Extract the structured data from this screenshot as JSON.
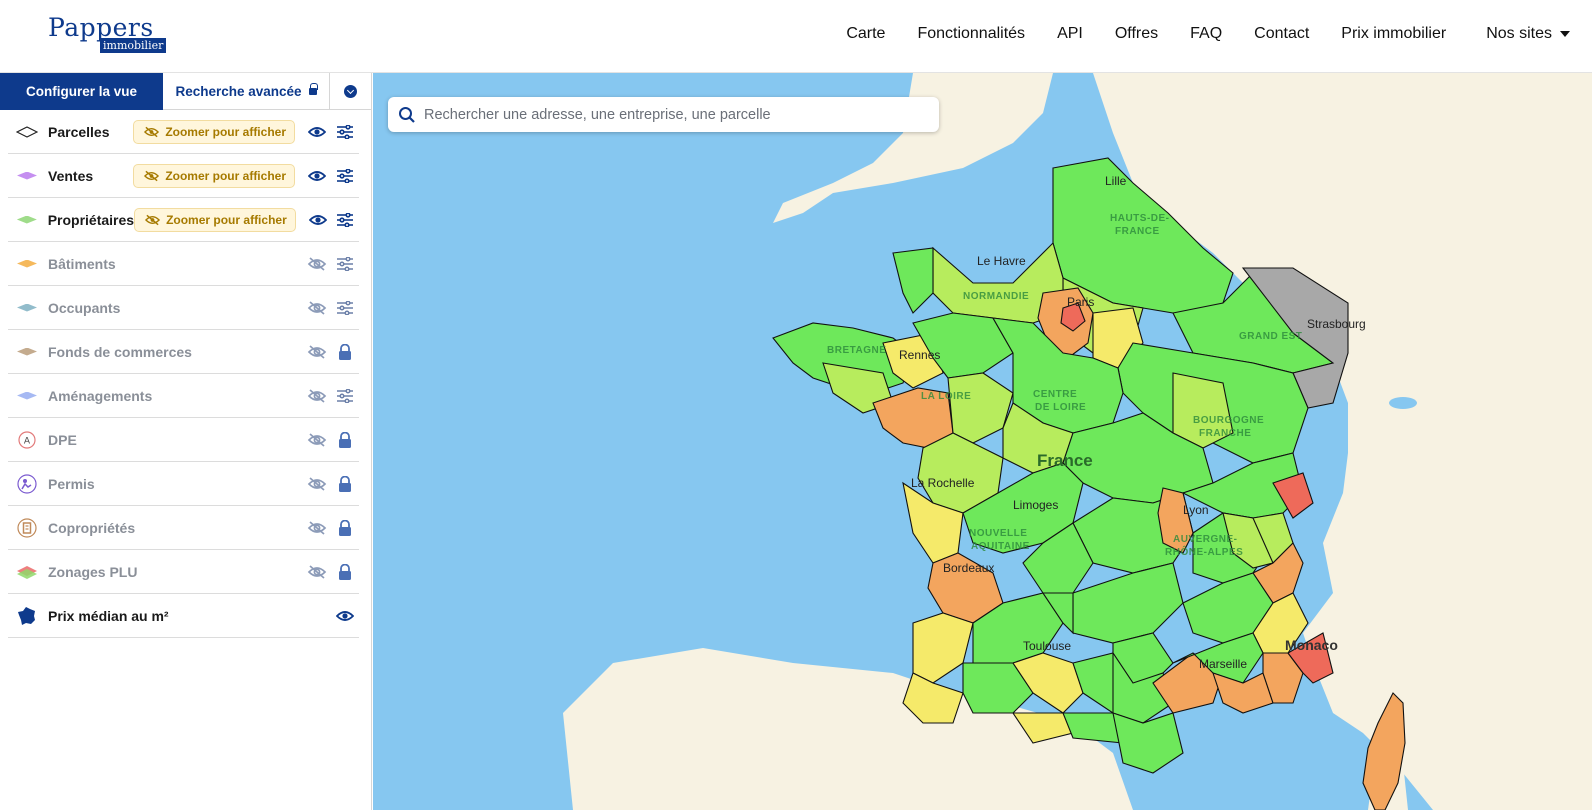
{
  "header": {
    "logo_main": "Pappers",
    "logo_sub": "immobilier",
    "nav": [
      "Carte",
      "Fonctionnalités",
      "API",
      "Offres",
      "FAQ",
      "Contact",
      "Prix immobilier"
    ],
    "sites_label": "Nos sites"
  },
  "sidebar": {
    "tabs": {
      "configure": "Configurer la vue",
      "advanced": "Recherche avancée"
    },
    "zoom_badge": "Zoomer pour afficher",
    "layers": [
      {
        "label": "Parcelles",
        "state": "zoom",
        "action": "settings"
      },
      {
        "label": "Ventes",
        "state": "zoom",
        "action": "settings"
      },
      {
        "label": "Propriétaires",
        "state": "zoom",
        "action": "settings"
      },
      {
        "label": "Bâtiments",
        "state": "hidden",
        "action": "settings"
      },
      {
        "label": "Occupants",
        "state": "hidden",
        "action": "settings"
      },
      {
        "label": "Fonds de commerces",
        "state": "hidden",
        "action": "lock"
      },
      {
        "label": "Aménagements",
        "state": "hidden",
        "action": "settings"
      },
      {
        "label": "DPE",
        "state": "hidden",
        "action": "lock"
      },
      {
        "label": "Permis",
        "state": "hidden",
        "action": "lock"
      },
      {
        "label": "Copropriétés",
        "state": "hidden",
        "action": "lock"
      },
      {
        "label": "Zonages PLU",
        "state": "hidden",
        "action": "lock"
      },
      {
        "label": "Prix médian au m²",
        "state": "visible",
        "action": "none"
      }
    ]
  },
  "map": {
    "search_placeholder": "Rechercher une adresse, une entreprise, une parcelle",
    "labels": {
      "lille": "Lille",
      "le_havre": "Le Havre",
      "paris": "Paris",
      "strasbourg": "Strasbourg",
      "rennes": "Rennes",
      "france": "France",
      "la_rochelle": "La Rochelle",
      "limoges": "Limoges",
      "lyon": "Lyon",
      "bordeaux": "Bordeaux",
      "toulouse": "Toulouse",
      "marseille": "Marseille",
      "monaco": "Monaco"
    },
    "regions": {
      "normandie": "NORMANDIE",
      "bretagne": "BRETAGNE",
      "loire": "LA LOIRE",
      "centre": "CENTRE",
      "centre2": "DE LOIRE",
      "grand_est": "GRAND EST",
      "bourgogne": "BOURGOGNE",
      "bourgogne2": "FRANCHE",
      "nouvelle": "NOUVELLE",
      "nouvelle2": "AQUITAINE",
      "auvergne": "AUVERGNE-",
      "auvergne2": "RHÔNE-ALPES",
      "hauts": "HAUTS-DE-",
      "hauts2": "FRANCE"
    },
    "colors": {
      "green": "#6ee85b",
      "light_green": "#b7ec5d",
      "yellow": "#f5ea6a",
      "orange": "#f3a55e",
      "red": "#ee6a5a",
      "grey": "#a8a8a8"
    }
  }
}
